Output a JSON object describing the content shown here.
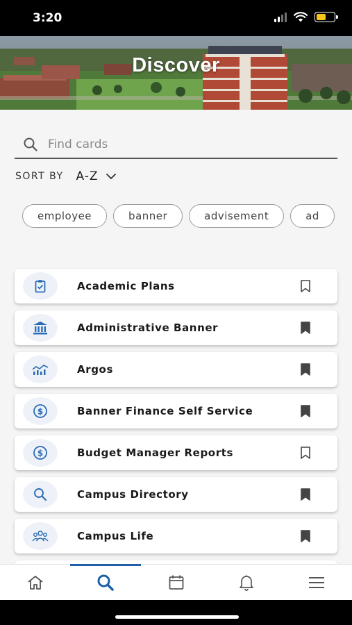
{
  "status_bar": {
    "time": "3:20",
    "signal_icon": "cellular-signal-icon",
    "wifi_icon": "wifi-icon",
    "battery_icon": "battery-icon",
    "battery_level": 0.6,
    "battery_color": "#f5c518"
  },
  "header": {
    "title": "Discover",
    "background": "campus-aerial-photo"
  },
  "search": {
    "placeholder": "Find cards",
    "value": "",
    "icon": "search-icon"
  },
  "sort": {
    "label": "SORT BY",
    "value": "A-Z",
    "icon": "chevron-down-icon"
  },
  "chips": [
    {
      "label": "employee"
    },
    {
      "label": "banner"
    },
    {
      "label": "advisement"
    },
    {
      "label": "ad"
    }
  ],
  "cards": [
    {
      "label": "Academic Plans",
      "icon": "clipboard-check-icon",
      "bookmarked": false
    },
    {
      "label": "Administrative Banner",
      "icon": "bank-building-icon",
      "bookmarked": true
    },
    {
      "label": "Argos",
      "icon": "analytics-chart-icon",
      "bookmarked": true
    },
    {
      "label": "Banner Finance Self Service",
      "icon": "dollar-circle-icon",
      "bookmarked": true
    },
    {
      "label": "Budget Manager Reports",
      "icon": "dollar-circle-icon",
      "bookmarked": false
    },
    {
      "label": "Campus Directory",
      "icon": "search-icon",
      "bookmarked": true
    },
    {
      "label": "Campus Life",
      "icon": "people-group-icon",
      "bookmarked": true
    }
  ],
  "bottom_nav": [
    {
      "name": "home",
      "icon": "home-icon",
      "active": false
    },
    {
      "name": "discover",
      "icon": "search-icon",
      "active": true
    },
    {
      "name": "calendar",
      "icon": "calendar-icon",
      "active": false
    },
    {
      "name": "notifications",
      "icon": "bell-icon",
      "active": false
    },
    {
      "name": "menu",
      "icon": "hamburger-menu-icon",
      "active": false
    }
  ],
  "colors": {
    "accent": "#1f5fa8",
    "icon_blue": "#2a6bb5",
    "bookmark": "#444444"
  }
}
